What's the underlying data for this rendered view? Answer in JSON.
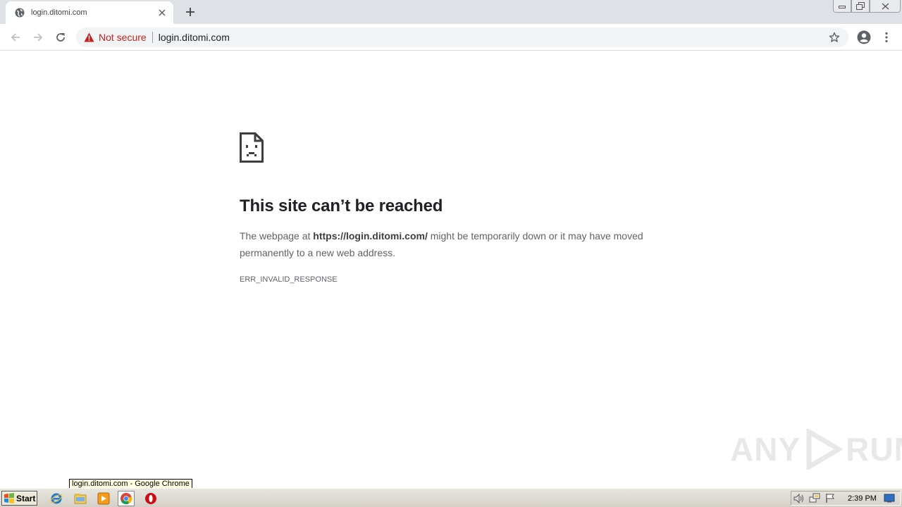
{
  "browser": {
    "tab": {
      "title": "login.ditomi.com",
      "favicon": "globe-icon"
    },
    "omnibox": {
      "security_label": "Not secure",
      "url": "login.ditomi.com"
    }
  },
  "error_page": {
    "title": "This site can’t be reached",
    "description_prefix": "The webpage at ",
    "description_url": "https://login.ditomi.com/",
    "description_suffix": " might be temporarily down or it may have moved permanently to a new web address.",
    "error_code": "ERR_INVALID_RESPONSE"
  },
  "watermark": {
    "left": "ANY",
    "right": "RUN"
  },
  "tooltip": {
    "text": "login.ditomi.com - Google Chrome"
  },
  "taskbar": {
    "start_label": "Start",
    "pinned": [
      "internet-explorer-icon",
      "folder-icon",
      "media-player-icon",
      "chrome-icon",
      "opera-icon"
    ],
    "clock": "2:39 PM"
  },
  "colors": {
    "not_secure": "#c5221f",
    "title_text": "#202124",
    "body_text": "#5f6368"
  }
}
